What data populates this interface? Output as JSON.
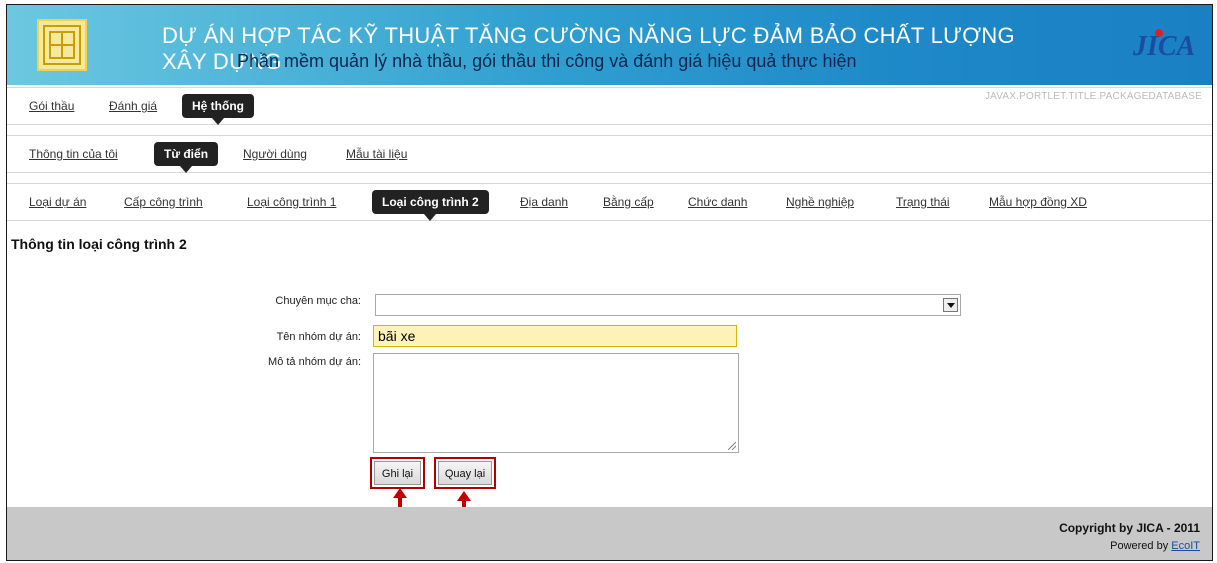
{
  "header": {
    "title_line1": "DỰ ÁN HỢP TÁC KỸ THUẬT TĂNG CƯỜNG NĂNG LỰC ĐẢM BẢO CHẤT LƯỢNG XÂY DỰNG",
    "title_line2": "Phần mềm quản lý nhà thầu, gói thầu thi công và đánh giá hiệu quả thực hiện",
    "jica_logo_text": "JICA",
    "portlet_title": "JAVAX.PORTLET.TITLE.PACKAGEDATABASE"
  },
  "nav1": {
    "items": [
      "Gói thầu",
      "Đánh giá",
      "Hệ thống"
    ],
    "active": "Hệ thống"
  },
  "nav2": {
    "items": [
      "Thông tin của tôi",
      "Từ điển",
      "Người dùng",
      "Mẫu tài liệu"
    ],
    "active": "Từ điển"
  },
  "nav3": {
    "items": [
      "Loại dự án",
      "Cấp công trình",
      "Loại công trình 1",
      "Loại công trình 2",
      "Địa danh",
      "Bằng cấp",
      "Chức danh",
      "Nghề nghiệp",
      "Trạng thái",
      "Mẫu hợp đồng XD"
    ],
    "active": "Loại công trình 2"
  },
  "form": {
    "heading": "Thông tin loại công trình 2",
    "parent_label": "Chuyên mục cha:",
    "parent_value": "",
    "name_label": "Tên nhóm dự án:",
    "name_value": "bãi xe",
    "desc_label": "Mô tả nhóm dự án:",
    "desc_value": "",
    "save_label": "Ghi lại",
    "back_label": "Quay lại"
  },
  "footer": {
    "copyright": "Copyright by JICA - 2011",
    "powered_prefix": "Powered by ",
    "powered_link": "EcoIT"
  },
  "colors": {
    "banner_start": "#6cc8e0",
    "banner_end": "#1a80c4",
    "active_tab": "#222222",
    "highlight_border": "#b00000",
    "input_highlight": "#fdf2b8"
  }
}
